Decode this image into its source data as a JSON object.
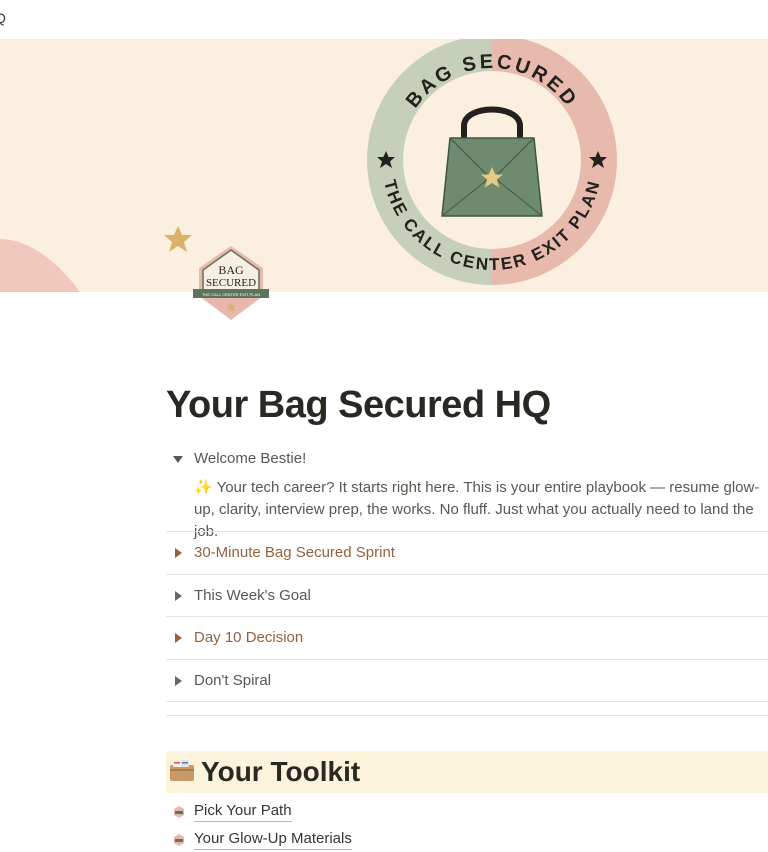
{
  "window": {
    "cut_text": "Q"
  },
  "cover": {
    "badge_top_text": "BAG SECURED",
    "badge_bottom_text": "THE CALL CENTER EXIT PLAN",
    "colors": {
      "background": "#fbefe0",
      "ring_green": "#c5cfb9",
      "ring_pink": "#e8b9ad",
      "bag_green": "#6e8a6f"
    }
  },
  "page_icon": {
    "line1": "BAG",
    "line2": "SECURED",
    "line3": "THE CALL CENTER EXIT PLAN"
  },
  "page": {
    "title": "Your Bag Secured HQ",
    "welcome": {
      "label": "Welcome Bestie!",
      "body": "✨ Your tech career? It starts right here. This is your entire playbook — resume glow-up, clarity, interview prep, the works. No fluff. Just what you actually need to land the job."
    },
    "toggles": [
      {
        "label": "30-Minute Bag Secured Sprint"
      },
      {
        "label": "This Week's Goal"
      },
      {
        "label": "Day 10 Decision"
      },
      {
        "label": "Don't Spiral"
      }
    ]
  },
  "toolkit": {
    "heading": "Your Toolkit",
    "items": [
      {
        "label": "Pick Your Path"
      },
      {
        "label": "Your Glow-Up Materials"
      }
    ]
  }
}
